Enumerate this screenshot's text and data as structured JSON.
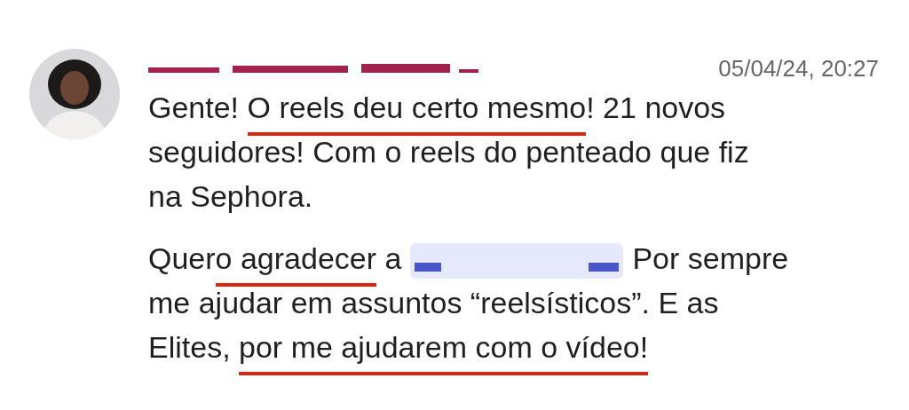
{
  "message": {
    "timestamp": "05/04/24, 20:27",
    "paragraphs": [
      {
        "lines": [
          [
            {
              "kind": "plain",
              "text": "Gente! "
            },
            {
              "kind": "underlined",
              "text": "O reels deu certo mesmo"
            },
            {
              "kind": "plain",
              "text": "! 21 novos"
            }
          ],
          [
            {
              "kind": "plain",
              "text": "seguidores! Com o reels do penteado que fiz"
            }
          ],
          [
            {
              "kind": "plain",
              "text": "na Sephora."
            }
          ]
        ]
      },
      {
        "lines": [
          [
            {
              "kind": "plain",
              "text": "Quer"
            },
            {
              "kind": "underlined",
              "text": "o agradecer"
            },
            {
              "kind": "plain",
              "text": " a"
            },
            {
              "kind": "mention"
            },
            {
              "kind": "plain",
              "text": "Por sempre"
            }
          ],
          [
            {
              "kind": "plain",
              "text": "me ajudar em assuntos “reelsísticos”. E as"
            }
          ],
          [
            {
              "kind": "plain",
              "text": "Elites, "
            },
            {
              "kind": "underlined",
              "text": "por me ajudarem com o vídeo!"
            }
          ]
        ]
      }
    ]
  }
}
